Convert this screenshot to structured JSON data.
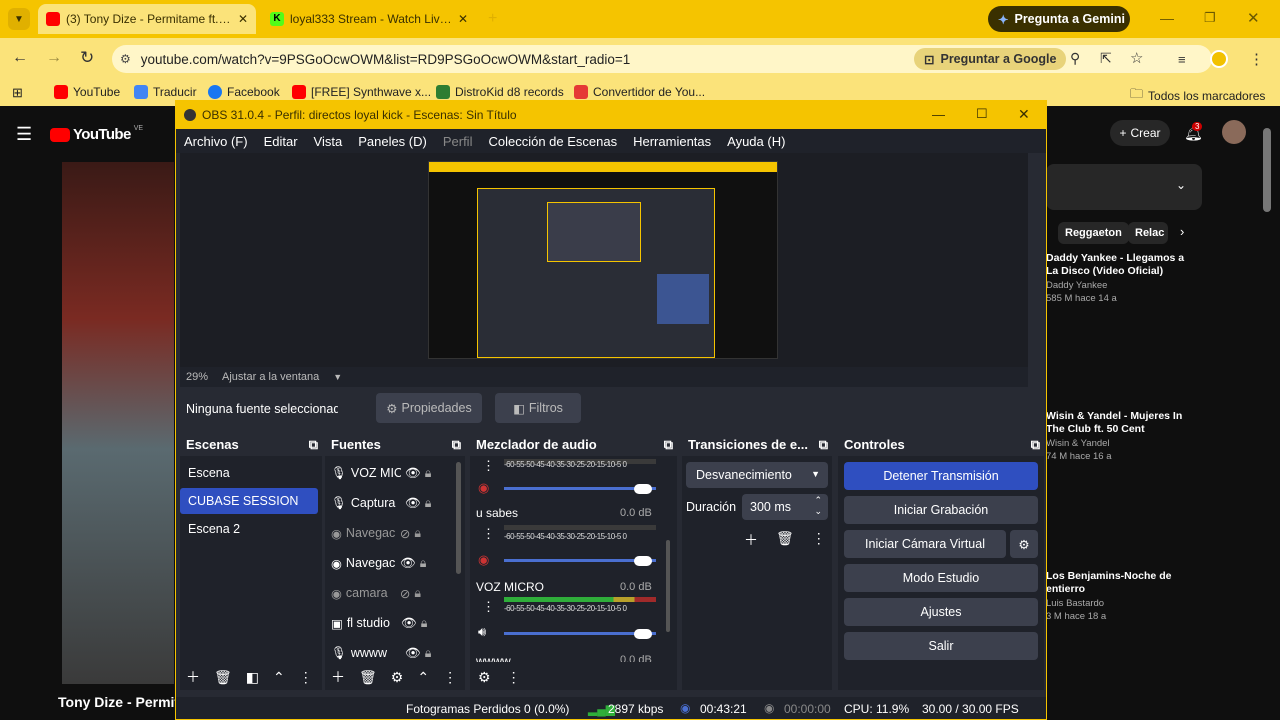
{
  "chrome": {
    "tabs": [
      {
        "title": "(3) Tony Dize - Permitame ft. Ya",
        "favicon_color": "#ff0000",
        "active": true
      },
      {
        "title": "loyal333 Stream - Watch Live o",
        "favicon_color": "#53fc18",
        "active": false
      }
    ],
    "gemini_label": "Pregunta a Gemini",
    "url": "youtube.com/watch?v=9PSGoOcwOWM&list=RD9PSGoOcwOWM&start_radio=1",
    "google_label": "Preguntar a Google",
    "bookmarks": [
      {
        "label": "YouTube",
        "color": "#ff0000"
      },
      {
        "label": "Traducir",
        "color": "#4285f4"
      },
      {
        "label": "Facebook",
        "color": "#1877f2"
      },
      {
        "label": "[FREE] Synthwave x...",
        "color": "#ff0000"
      },
      {
        "label": "DistroKid d8 records",
        "color": "#2e7d32"
      },
      {
        "label": "Convertidor de You...",
        "color": "#e53935"
      }
    ],
    "all_bookmarks": "Todos los marcadores"
  },
  "youtube": {
    "logo": "YouTube",
    "country": "VE",
    "create_label": "Crear",
    "notif_count": "3",
    "chips": [
      "Reggaeton",
      "Relac"
    ],
    "video_title": "Tony Dize - Permit",
    "suggestions": [
      {
        "title": "Daddy Yankee - Llegamos a La Disco (Video Oficial)",
        "channel": "Daddy Yankee",
        "meta": "585 M  hace 14 a"
      },
      {
        "title": "Wisin & Yandel - Mujeres In The Club ft. 50 Cent",
        "channel": "Wisin & Yandel",
        "meta": "74 M  hace 16 a"
      },
      {
        "title": "Los Benjamins-Noche de entierro",
        "channel": "Luis Bastardo",
        "meta": "3 M  hace 18 a"
      }
    ]
  },
  "obs": {
    "title": "OBS 31.0.4 - Perfil: directos loyal kick - Escenas: Sin Título",
    "menu": [
      "Archivo (F)",
      "Editar",
      "Vista",
      "Paneles (D)",
      "Perfil",
      "Colección de Escenas",
      "Herramientas",
      "Ayuda (H)"
    ],
    "zoom": "29%",
    "fit_label": "Ajustar a la ventana",
    "no_source": "Ninguna fuente seleccionad",
    "props_label": "Propiedades",
    "filters_label": "Filtros",
    "scenes_title": "Escenas",
    "scenes": [
      "Escena",
      "CUBASE SESSION",
      "Escena 2"
    ],
    "sources_title": "Fuentes",
    "sources": [
      "VOZ MIC",
      "Captura",
      "Navegac",
      "Navegac",
      "camara",
      "fl studio",
      "wwww"
    ],
    "mixer_title": "Mezclador de audio",
    "ticks": "-60-55-50-45-40-35-30-25-20-15-10-5 0",
    "channels": [
      {
        "name": "u sabes",
        "db": "0.0 dB"
      },
      {
        "name": "VOZ MICRO",
        "db": "0.0 dB"
      },
      {
        "name": "wwww",
        "db": "0.0 dB"
      }
    ],
    "transitions_title": "Transiciones de e...",
    "transition": "Desvanecimiento",
    "duration_label": "Duración",
    "duration_value": "300 ms",
    "controls_title": "Controles",
    "controls": [
      "Detener Transmisión",
      "Iniciar Grabación",
      "Iniciar Cámara Virtual",
      "Modo Estudio",
      "Ajustes",
      "Salir"
    ],
    "status": {
      "dropped": "Fotogramas Perdidos 0 (0.0%)",
      "kbps": "2897 kbps",
      "live_time": "00:43:21",
      "rec_time": "00:00:00",
      "cpu": "CPU: 11.9%",
      "fps": "30.00 / 30.00 FPS"
    }
  }
}
